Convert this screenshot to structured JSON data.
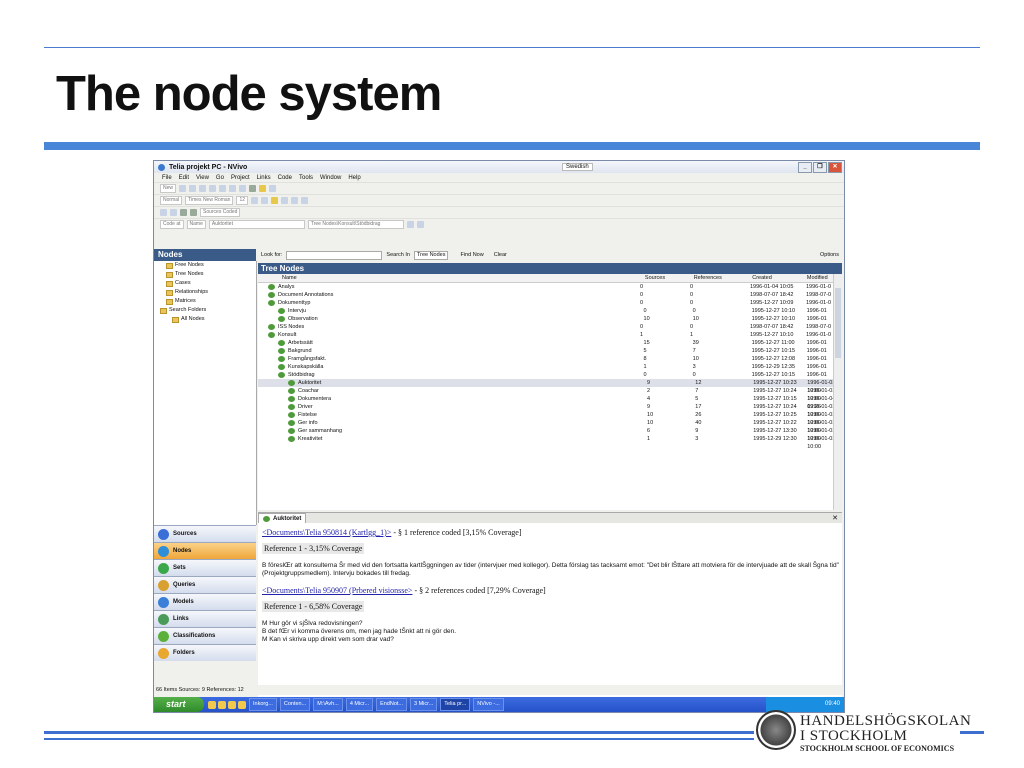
{
  "slide": {
    "title": "The node system",
    "logo_line1": "HANDELSHÖGSKOLAN",
    "logo_line2": "I STOCKHOLM",
    "logo_line3": "STOCKHOLM SCHOOL OF ECONOMICS"
  },
  "window": {
    "title": "Telia projekt PC - NVivo",
    "language": "Swedish",
    "menu": [
      "File",
      "Edit",
      "View",
      "Go",
      "Project",
      "Links",
      "Code",
      "Tools",
      "Window",
      "Help"
    ],
    "toolbar": {
      "new_label": "New",
      "style": "Normal",
      "font": "Times New Roman",
      "size": "12",
      "sources_coded": "Sources Coded",
      "code_at": "Code at",
      "name_field": "Name",
      "node_value": "Auktoritet",
      "path_value": "Tree Nodes\\Konsult\\Stödbidrag"
    }
  },
  "left_pane": {
    "header": "Nodes",
    "tree": [
      {
        "label": "Free Nodes",
        "indent": 1
      },
      {
        "label": "Tree Nodes",
        "indent": 1
      },
      {
        "label": "Cases",
        "indent": 1
      },
      {
        "label": "Relationships",
        "indent": 1
      },
      {
        "label": "Matrices",
        "indent": 1
      },
      {
        "label": "Search Folders",
        "indent": 0
      },
      {
        "label": "All Nodes",
        "indent": 2
      }
    ],
    "nav": [
      "Sources",
      "Nodes",
      "Sets",
      "Queries",
      "Models",
      "Links",
      "Classifications",
      "Folders"
    ]
  },
  "search": {
    "look_for": "Look for:",
    "search_in": "Search In",
    "search_target": "Tree Nodes",
    "find_now": "Find Now",
    "clear": "Clear",
    "options": "Options"
  },
  "tree_nodes": {
    "header": "Tree Nodes",
    "columns": [
      "Name",
      "Sources",
      "References",
      "Created",
      "Modified"
    ],
    "rows": [
      {
        "name": "Analys",
        "level": 0,
        "sources": "0",
        "references": "0",
        "created": "1996-01-04 10:05",
        "modified": "1996-01-0"
      },
      {
        "name": "Document Annotations",
        "level": 0,
        "sources": "0",
        "references": "0",
        "created": "1998-07-07 18:42",
        "modified": "1998-07-0"
      },
      {
        "name": "Dokumenttyp",
        "level": 0,
        "sources": "0",
        "references": "0",
        "created": "1995-12-27 10:09",
        "modified": "1996-01-0"
      },
      {
        "name": "Intervju",
        "level": 1,
        "sources": "0",
        "references": "0",
        "created": "1995-12-27 10:10",
        "modified": "1996-01"
      },
      {
        "name": "Observation",
        "level": 1,
        "sources": "10",
        "references": "10",
        "created": "1995-12-27 10:10",
        "modified": "1996-01"
      },
      {
        "name": "ISS Nodes",
        "level": 0,
        "sources": "0",
        "references": "0",
        "created": "1998-07-07 18:42",
        "modified": "1998-07-0"
      },
      {
        "name": "Konsult",
        "level": 0,
        "sources": "1",
        "references": "1",
        "created": "1995-12-27 10:10",
        "modified": "1996-01-0"
      },
      {
        "name": "Arbetssätt",
        "level": 1,
        "sources": "15",
        "references": "39",
        "created": "1995-12-27 11:00",
        "modified": "1996-01"
      },
      {
        "name": "Bakgrund",
        "level": 1,
        "sources": "5",
        "references": "7",
        "created": "1995-12-27 10:15",
        "modified": "1996-01"
      },
      {
        "name": "Framgångsfakt.",
        "level": 1,
        "sources": "8",
        "references": "10",
        "created": "1995-12-27 12:08",
        "modified": "1996-01"
      },
      {
        "name": "Kunskapskälla",
        "level": 1,
        "sources": "1",
        "references": "3",
        "created": "1995-12-29 12:35",
        "modified": "1996-01"
      },
      {
        "name": "Stödbidrag",
        "level": 1,
        "sources": "0",
        "references": "0",
        "created": "1995-12-27 10:15",
        "modified": "1996-01"
      },
      {
        "name": "Auktoritet",
        "level": 2,
        "sources": "9",
        "references": "12",
        "created": "1995-12-27 10:23",
        "modified": "1996-01-03 10:00",
        "selected": true
      },
      {
        "name": "Coachar",
        "level": 2,
        "sources": "2",
        "references": "7",
        "created": "1995-12-27 10:24",
        "modified": "1996-01-03 10:00"
      },
      {
        "name": "Dokumentera",
        "level": 2,
        "sources": "4",
        "references": "5",
        "created": "1995-12-27 10:15",
        "modified": "1996-01-04 09:26"
      },
      {
        "name": "Driver",
        "level": 2,
        "sources": "9",
        "references": "17",
        "created": "1995-12-27 10:24",
        "modified": "1996-01-03 10:00"
      },
      {
        "name": "Fistelse",
        "level": 2,
        "sources": "10",
        "references": "26",
        "created": "1995-12-27 10:25",
        "modified": "1996-01-03 10:00"
      },
      {
        "name": "Ger info",
        "level": 2,
        "sources": "10",
        "references": "40",
        "created": "1995-12-27 10:22",
        "modified": "1996-01-03 10:00"
      },
      {
        "name": "Ger sammanhang",
        "level": 2,
        "sources": "6",
        "references": "9",
        "created": "1995-12-27 13:30",
        "modified": "1996-01-03 10:00"
      },
      {
        "name": "Kreativitet",
        "level": 2,
        "sources": "1",
        "references": "3",
        "created": "1995-12-29 12:30",
        "modified": "1996-01-03 10:00"
      }
    ]
  },
  "detail": {
    "tab_label": "Auktoritet",
    "doc1_link": "<Documents\\Telia 950814 (Kartlgg_1)>",
    "doc1_suffix": " - § 1 reference coded  [3,15% Coverage]",
    "ref1": "Reference 1 - 3,15% Coverage",
    "ref1_text": "B föreslŒr att konsulterna Šr med vid den fortsatta kartlŠggningen av tider (intervjuer med kollegor). Detta förslag tas tacksamt emot: \"Det blir lŠttare att motviera för de intervjuade att de skall Šgna tid\" (Projektgruppsmedlem). Intervju bokades till fredag.",
    "doc2_link": "<Documents\\Telia 950907 (Prbered visionsse>",
    "doc2_suffix": " - § 2 references coded  [7,29% Coverage]",
    "ref2": "Reference 1 - 6,58% Coverage",
    "ref2_lines": [
      "M Hur gör vi sjŠlva redovisningen?",
      "B det fŒr vi komma överens om, men jag hade tŠnkt att ni gör den.",
      "M Kan vi skriva upp direkt vem som drar vad?"
    ]
  },
  "status": "66 Items  Sources: 9  References: 12",
  "taskbar": {
    "start": "start",
    "tasks": [
      "Inkorg...",
      "Conten...",
      "M:\\Avh...",
      "4 Micr...",
      "EndNot...",
      "3 Micr...",
      "Telia pr...",
      "NVivo -..."
    ],
    "clock": "09:40"
  }
}
